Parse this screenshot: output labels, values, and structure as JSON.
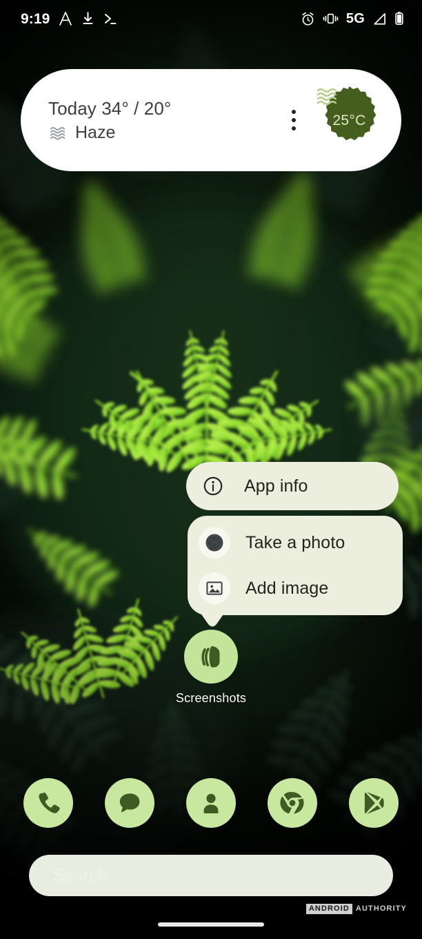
{
  "status_bar": {
    "time": "9:19",
    "left_icons": [
      "navigation-icon",
      "download-icon",
      "terminal-icon"
    ],
    "right_icons": [
      "alarm-icon",
      "vibrate-icon",
      "signal-icon",
      "battery-icon"
    ],
    "network_label": "5G"
  },
  "weather_widget": {
    "today_line": "Today 34° / 20°",
    "condition": "Haze",
    "condition_icon": "haze-waves-icon",
    "current_temp": "25°C",
    "badge_icon": "haze-waves-icon",
    "menu_icon": "overflow-menu-icon",
    "badge_color": "#465e1d",
    "background_color": "#ffffff"
  },
  "popup_menu": {
    "app_info": {
      "label": "App info",
      "icon": "info-icon"
    },
    "shortcuts": [
      {
        "label": "Take a photo",
        "icon": "camera-aperture-icon"
      },
      {
        "label": "Add image",
        "icon": "image-icon"
      }
    ],
    "card_color": "#eceede",
    "icon_circle_color": "#f7f8f0"
  },
  "app_icon": {
    "label": "Screenshots",
    "icon": "screenshots-layers-icon",
    "circle_color": "#c2e59a",
    "glyph_color": "#3f5a22"
  },
  "dock": {
    "items": [
      {
        "label": "Phone",
        "icon": "phone-icon"
      },
      {
        "label": "Messages",
        "icon": "messages-icon"
      },
      {
        "label": "Contacts",
        "icon": "contacts-icon"
      },
      {
        "label": "Chrome",
        "icon": "chrome-icon"
      },
      {
        "label": "Play Store",
        "icon": "play-store-icon"
      }
    ],
    "circle_color": "#c8e8a0",
    "glyph_color": "#3f5a22"
  },
  "search_bar": {
    "placeholder": "Search",
    "value": "",
    "background_color": "#e9ece0"
  },
  "watermark": {
    "brand_boxed": "ANDROID",
    "brand_plain": "AUTHORITY"
  },
  "navigation": {
    "gesture_bar": "gesture-home-bar"
  }
}
